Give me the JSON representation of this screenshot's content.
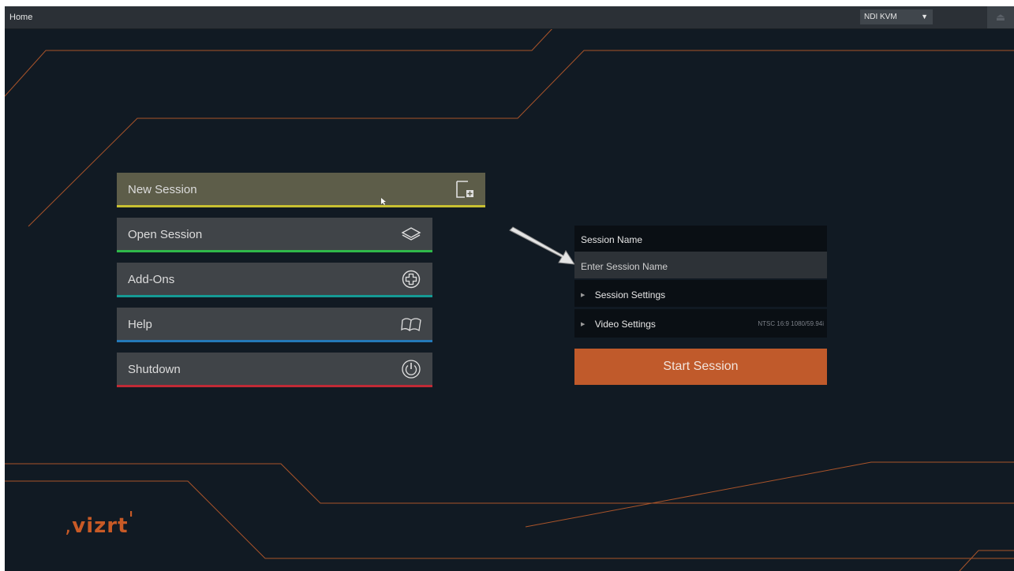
{
  "topbar": {
    "title": "Home",
    "output_select": "NDI KVM"
  },
  "menu": [
    {
      "label": "New Session",
      "stripe": "#c8c031",
      "icon": "new-session-icon"
    },
    {
      "label": "Open Session",
      "stripe": "#2fb84a",
      "icon": "open-session-icon"
    },
    {
      "label": "Add-Ons",
      "stripe": "#159a94",
      "icon": "add-ons-icon"
    },
    {
      "label": "Help",
      "stripe": "#2479b8",
      "icon": "help-book-icon"
    },
    {
      "label": "Shutdown",
      "stripe": "#c02a35",
      "icon": "power-icon"
    }
  ],
  "session_panel": {
    "name_label": "Session Name",
    "name_placeholder": "Enter Session Name",
    "session_settings": "Session Settings",
    "video_settings": "Video Settings",
    "video_format": "NTSC 16:9 1080/59.94i",
    "start_label": "Start Session"
  },
  "branding": {
    "logo_text": "vizrt",
    "accent": "#c85a26"
  }
}
